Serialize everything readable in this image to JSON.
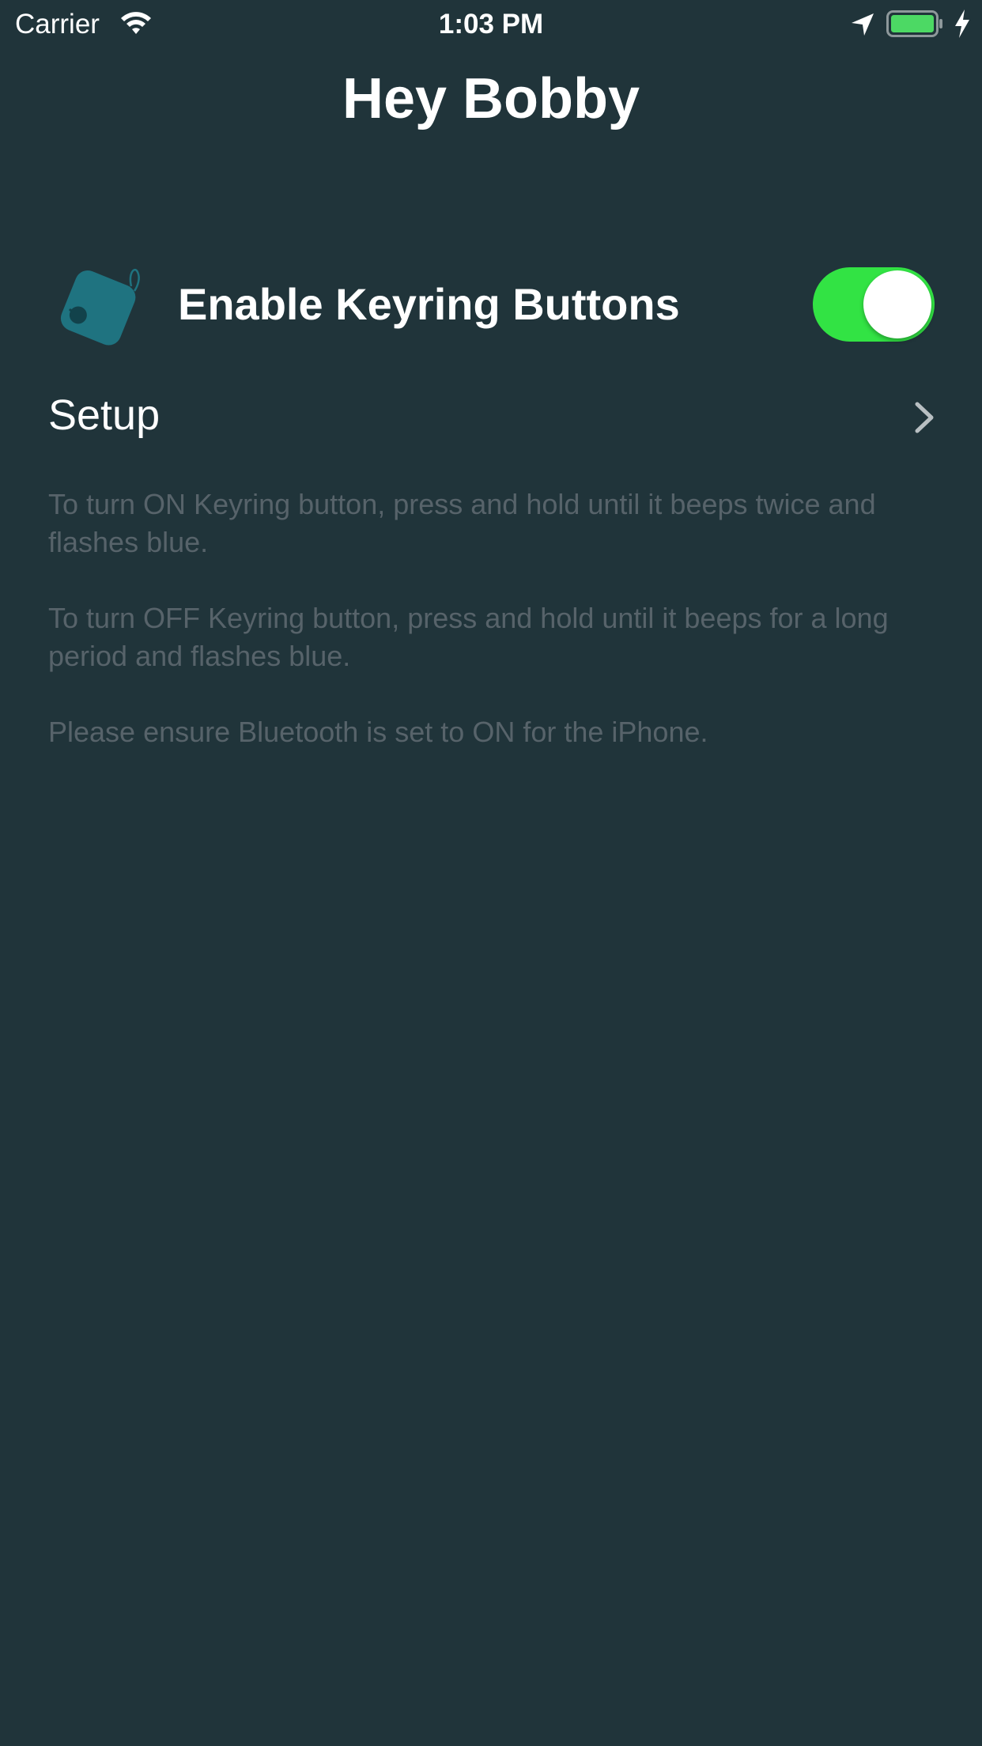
{
  "status_bar": {
    "carrier": "Carrier",
    "time": "1:03 PM",
    "icons": [
      "wifi-icon",
      "location-arrow-icon",
      "battery-icon",
      "charging-bolt-icon"
    ],
    "battery_color": "#4cd964"
  },
  "header": {
    "title": "Hey Bobby"
  },
  "keyring": {
    "label": "Enable Keyring Buttons",
    "icon": "keyring-tag-icon",
    "icon_color": "#1f7380",
    "toggle_on": true,
    "toggle_color": "#32e344"
  },
  "setup": {
    "label": "Setup",
    "icon": "chevron-right-icon"
  },
  "instructions": [
    "To turn ON Keyring button, press and hold until it beeps twice and flashes blue.",
    "To turn OFF Keyring button, press and hold until it beeps for a long period and flashes blue.",
    "Please ensure Bluetooth is set to ON for the iPhone."
  ],
  "colors": {
    "background": "#20343a",
    "instruction_text": "#57636a"
  }
}
